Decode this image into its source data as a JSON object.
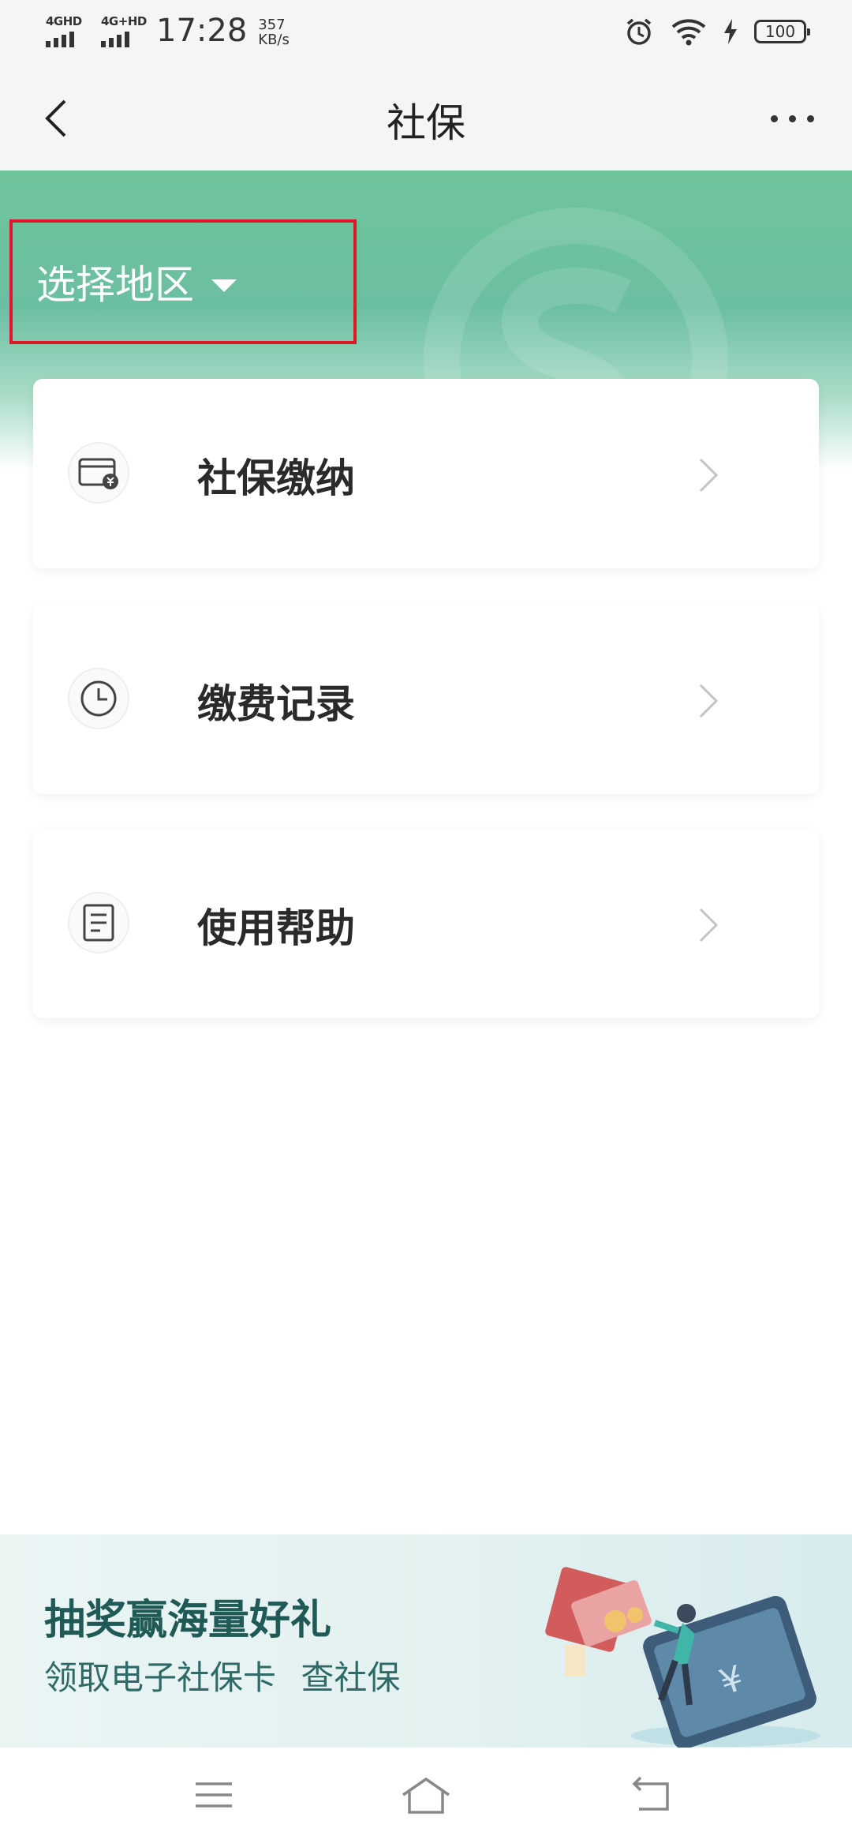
{
  "status_bar": {
    "network_1": "4GHD",
    "network_2": "4G+HD",
    "time": "17:28",
    "speed_value": "357",
    "speed_unit": "KB/s",
    "battery": "100",
    "icons": [
      "signal-icon",
      "alarm-icon",
      "wifi-icon",
      "charging-icon",
      "battery-icon"
    ]
  },
  "nav": {
    "title": "社保",
    "back_icon": "chevron-left-icon",
    "more_icon": "more-dots-icon"
  },
  "hero": {
    "region_label": "选择地区",
    "caret_icon": "caret-down-icon"
  },
  "menu": {
    "items": [
      {
        "label": "社保缴纳",
        "icon": "wallet-yuan-icon"
      },
      {
        "label": "缴费记录",
        "icon": "clock-icon"
      },
      {
        "label": "使用帮助",
        "icon": "document-icon"
      }
    ]
  },
  "banner": {
    "title": "抽奖赢海量好礼",
    "subtitle": "领取电子社保卡 查社保"
  },
  "system_nav": {
    "icons": [
      "menu-icon",
      "home-icon",
      "back-icon"
    ]
  },
  "colors": {
    "hero_green": "#6fc49b",
    "highlight_red": "#e0162b",
    "banner_text": "#1f5a56"
  }
}
